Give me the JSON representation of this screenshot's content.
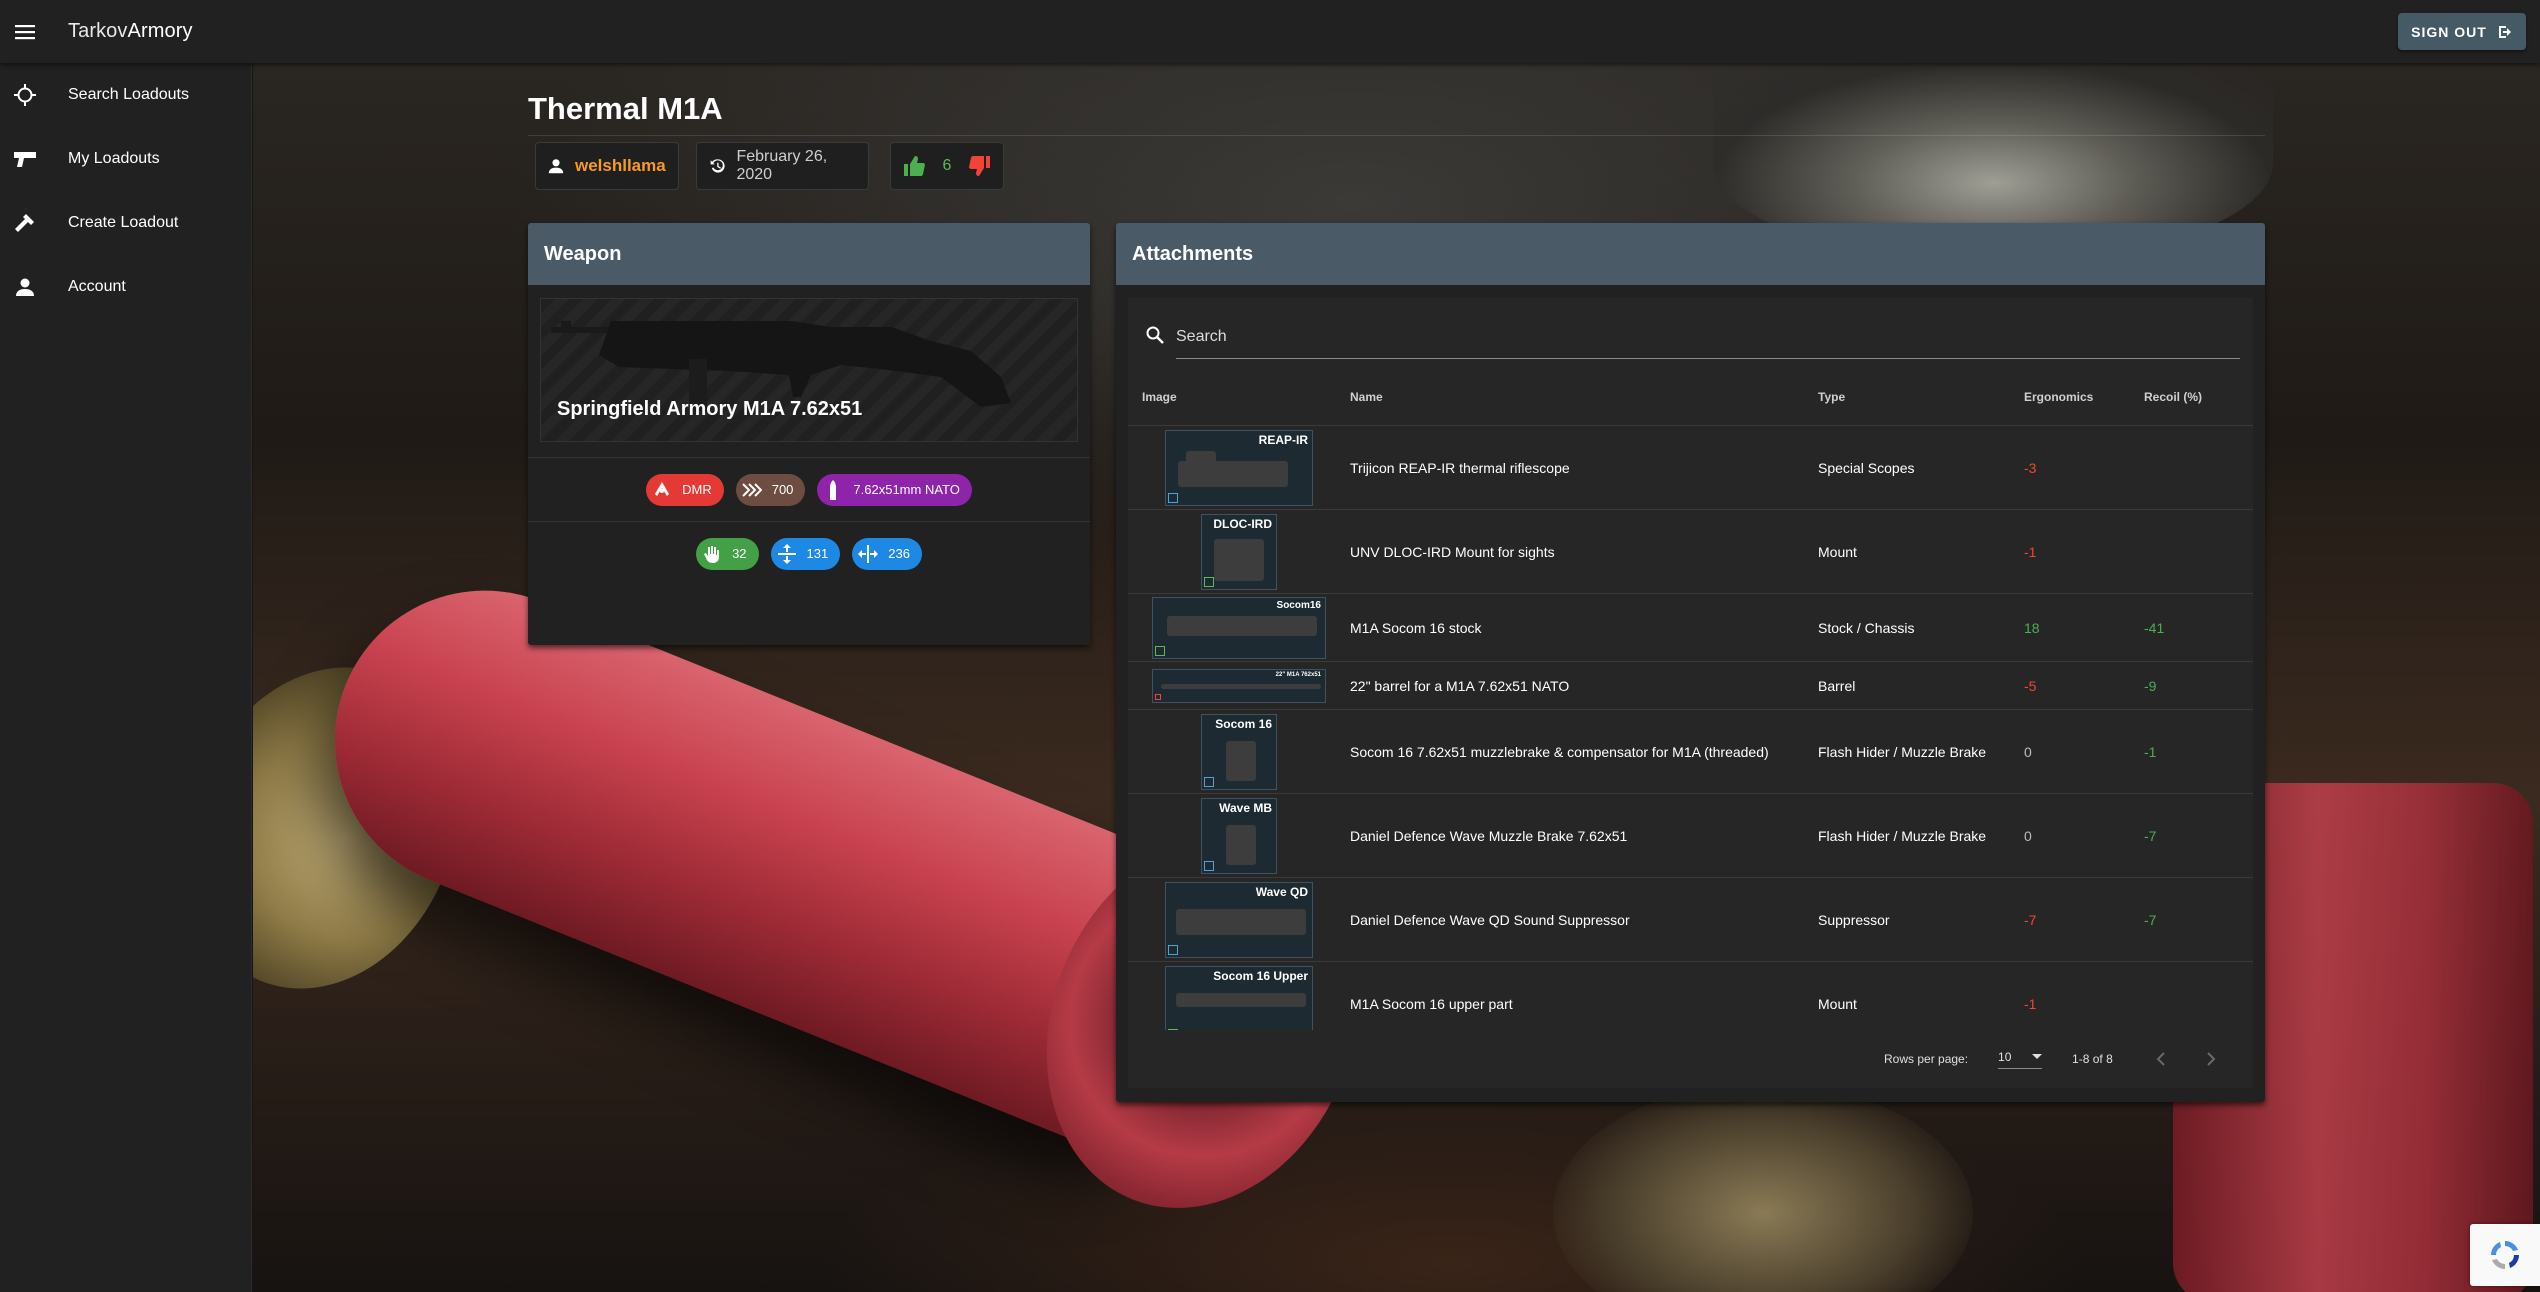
{
  "appbar": {
    "brand_part1": "Tarkov",
    "brand_part2": "Armory",
    "signout_label": "SIGN OUT"
  },
  "sidebar": {
    "items": [
      {
        "label": "Search Loadouts",
        "icon": "crosshair-icon"
      },
      {
        "label": "My Loadouts",
        "icon": "pistol-icon"
      },
      {
        "label": "Create Loadout",
        "icon": "hammer-icon"
      },
      {
        "label": "Account",
        "icon": "person-icon"
      }
    ]
  },
  "loadout": {
    "title": "Thermal M1A",
    "author": "welshllama",
    "date": "February 26, 2020",
    "votes": "6"
  },
  "weapon": {
    "header": "Weapon",
    "name": "Springfield Armory M1A 7.62x51",
    "class": "DMR",
    "fire_rate": "700",
    "caliber": "7.62x51mm NATO",
    "ergonomics": "32",
    "vertical_recoil": "131",
    "horizontal_recoil": "236",
    "colors": {
      "class": "#e53935",
      "fire_rate": "#6d4c41",
      "caliber": "#8e24aa",
      "ergonomics": "#43a047",
      "recoil": "#1e88e5"
    }
  },
  "attachments": {
    "header": "Attachments",
    "search_placeholder": "Search",
    "columns": {
      "image": "Image",
      "name": "Name",
      "type": "Type",
      "ergonomics": "Ergonomics",
      "recoil": "Recoil (%)"
    },
    "rows": [
      {
        "thumb_label": "REAP-IR",
        "name": "Trijicon REAP-IR thermal riflescope",
        "type": "Special Scopes",
        "ergonomics": "-3",
        "recoil": ""
      },
      {
        "thumb_label": "DLOC-IRD",
        "name": "UNV DLOC-IRD Mount for sights",
        "type": "Mount",
        "ergonomics": "-1",
        "recoil": ""
      },
      {
        "thumb_label": "Socom16",
        "name": "M1A Socom 16 stock",
        "type": "Stock / Chassis",
        "ergonomics": "18",
        "recoil": "-41"
      },
      {
        "thumb_label": "22\" M1A 762x51",
        "name": "22\" barrel for a M1A 7.62x51 NATO",
        "type": "Barrel",
        "ergonomics": "-5",
        "recoil": "-9"
      },
      {
        "thumb_label": "Socom 16",
        "name": "Socom 16 7.62x51 muzzlebrake & compensator for M1A (threaded)",
        "type": "Flash Hider / Muzzle Brake",
        "ergonomics": "0",
        "recoil": "-1"
      },
      {
        "thumb_label": "Wave MB",
        "name": "Daniel Defence Wave Muzzle Brake 7.62x51",
        "type": "Flash Hider / Muzzle Brake",
        "ergonomics": "0",
        "recoil": "-7"
      },
      {
        "thumb_label": "Wave QD",
        "name": "Daniel Defence Wave QD Sound Suppressor",
        "type": "Suppressor",
        "ergonomics": "-7",
        "recoil": "-7"
      },
      {
        "thumb_label": "Socom 16 Upper",
        "name": "M1A Socom 16 upper part",
        "type": "Mount",
        "ergonomics": "-1",
        "recoil": ""
      }
    ],
    "pagination": {
      "rows_per_page_label": "Rows per page:",
      "rows_per_page_value": "10",
      "range": "1-8 of 8"
    }
  }
}
